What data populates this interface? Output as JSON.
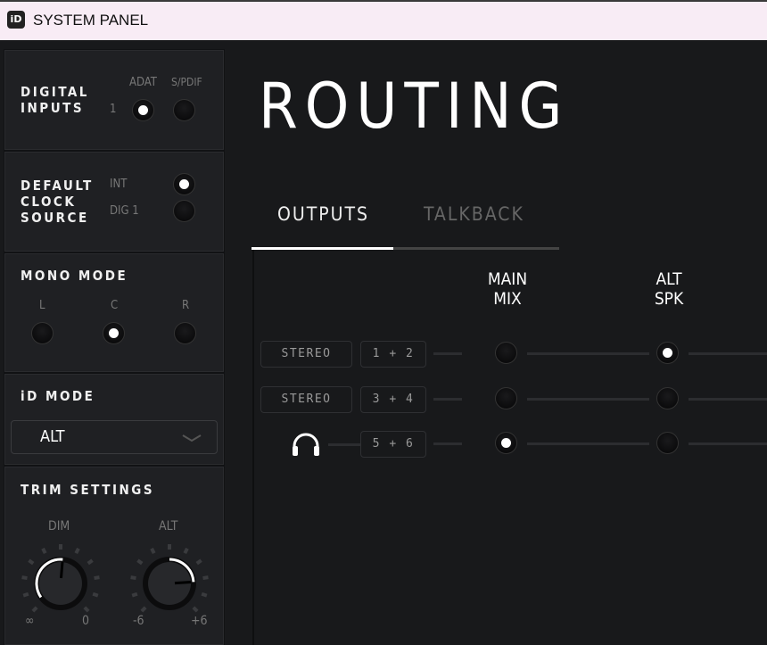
{
  "app": {
    "title": "SYSTEM PANEL",
    "logo": "iD"
  },
  "sidebar": {
    "digital_inputs": {
      "title": [
        "DIGITAL",
        "INPUTS"
      ],
      "columns": [
        "ADAT",
        "S/PDIF"
      ],
      "row_label": "1",
      "selected": "ADAT"
    },
    "clock_source": {
      "title": [
        "DEFAULT",
        "CLOCK",
        "SOURCE"
      ],
      "options": [
        "INT",
        "DIG 1"
      ],
      "selected": "INT"
    },
    "mono_mode": {
      "title": "MONO MODE",
      "options": [
        "L",
        "C",
        "R"
      ],
      "selected": "C"
    },
    "id_mode": {
      "title": "iD MODE",
      "value": "ALT"
    },
    "trim": {
      "title": "TRIM SETTINGS",
      "dim": {
        "label": "DIM",
        "min_label": "∞",
        "max_label": "0",
        "level": 0.5
      },
      "alt": {
        "label": "ALT",
        "min_label": "-6",
        "max_label": "+6",
        "level": 0.82
      }
    }
  },
  "main": {
    "title": "ROUTING",
    "tabs": [
      {
        "label": "OUTPUTS",
        "active": true
      },
      {
        "label": "TALKBACK",
        "active": false
      }
    ],
    "columns": [
      [
        "MAIN",
        "MIX"
      ],
      [
        "ALT",
        "SPK"
      ]
    ],
    "rows": [
      {
        "type": "STEREO",
        "channels": "1 + 2",
        "main_mix": false,
        "alt_spk": true
      },
      {
        "type": "STEREO",
        "channels": "3 + 4",
        "main_mix": false,
        "alt_spk": false
      },
      {
        "type": "headphones",
        "icon": "headphones-icon",
        "channels": "5 + 6",
        "main_mix": true,
        "alt_spk": false
      }
    ]
  }
}
